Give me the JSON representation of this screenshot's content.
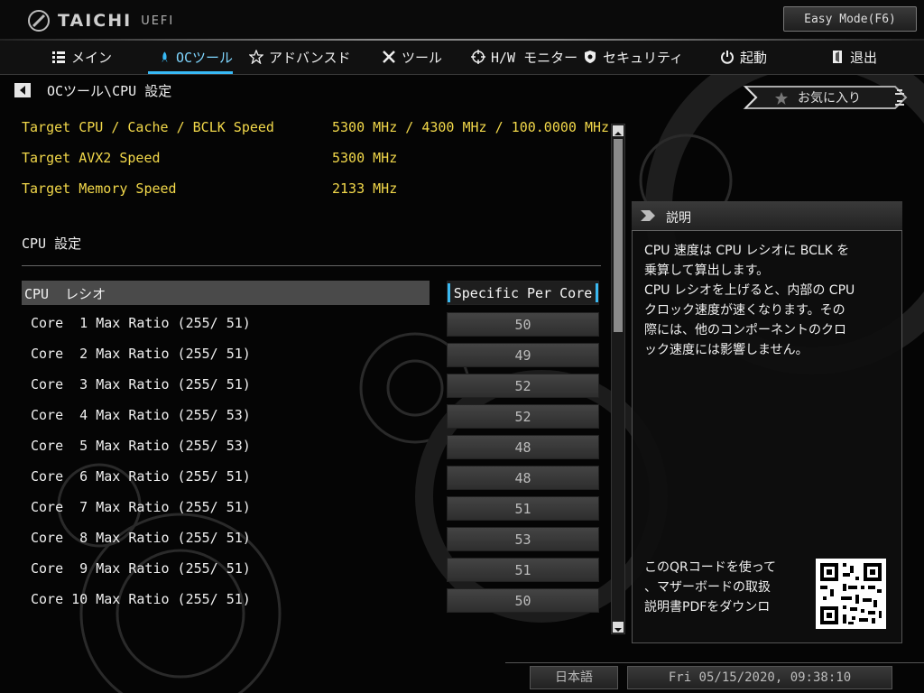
{
  "header": {
    "logo_text": "TAICHI",
    "logo_sub": "UEFI",
    "easy_mode": "Easy Mode(F6)"
  },
  "nav": {
    "items": [
      {
        "label": "メイン",
        "icon": "list-icon"
      },
      {
        "label": "OCツール",
        "icon": "rocket-icon",
        "active": true
      },
      {
        "label": "アドバンスド",
        "icon": "star-icon"
      },
      {
        "label": "ツール",
        "icon": "tools-icon"
      },
      {
        "label": "H/W モニター",
        "icon": "crosshair-icon"
      },
      {
        "label": "セキュリティ",
        "icon": "shield-icon"
      },
      {
        "label": "起動",
        "icon": "power-icon"
      },
      {
        "label": "退出",
        "icon": "exit-icon"
      }
    ]
  },
  "breadcrumb": "OCツール\\CPU 設定",
  "favorites_label": "お気に入り",
  "targets": [
    {
      "label": "Target CPU / Cache / BCLK Speed",
      "value": "5300 MHz / 4300 MHz / 100.0000 MHz"
    },
    {
      "label": "Target AVX2 Speed",
      "value": "5300 MHz"
    },
    {
      "label": "Target Memory Speed",
      "value": "2133 MHz"
    }
  ],
  "section_title": "CPU 設定",
  "cpu_ratio": {
    "label": "CPU  レシオ",
    "value": "Specific Per Core"
  },
  "cores": [
    {
      "label": "Core  1 Max Ratio (255/ 51)",
      "value": "50"
    },
    {
      "label": "Core  2 Max Ratio (255/ 51)",
      "value": "49"
    },
    {
      "label": "Core  3 Max Ratio (255/ 51)",
      "value": "52"
    },
    {
      "label": "Core  4 Max Ratio (255/ 53)",
      "value": "52"
    },
    {
      "label": "Core  5 Max Ratio (255/ 53)",
      "value": "48"
    },
    {
      "label": "Core  6 Max Ratio (255/ 51)",
      "value": "48"
    },
    {
      "label": "Core  7 Max Ratio (255/ 51)",
      "value": "51"
    },
    {
      "label": "Core  8 Max Ratio (255/ 51)",
      "value": "53"
    },
    {
      "label": "Core  9 Max Ratio (255/ 51)",
      "value": "51"
    },
    {
      "label": "Core 10 Max Ratio (255/ 51)",
      "value": "50"
    }
  ],
  "description": {
    "title": "説明",
    "lines": [
      "CPU 速度は CPU レシオに BCLK を",
      "乗算して算出します。",
      "CPU レシオを上げると、内部の CPU",
      "クロック速度が速くなります。その",
      "際には、他のコンポーネントのクロ",
      "ック速度には影響しません。"
    ],
    "qr_lines": [
      "このQRコードを使って",
      "、マザーボードの取扱",
      "説明書PDFをダウンロ"
    ]
  },
  "footer": {
    "language": "日本語",
    "datetime": "Fri 05/15/2020, 09:38:10"
  },
  "colors": {
    "accent": "#38b9f5",
    "target_text": "#f2d84a"
  }
}
